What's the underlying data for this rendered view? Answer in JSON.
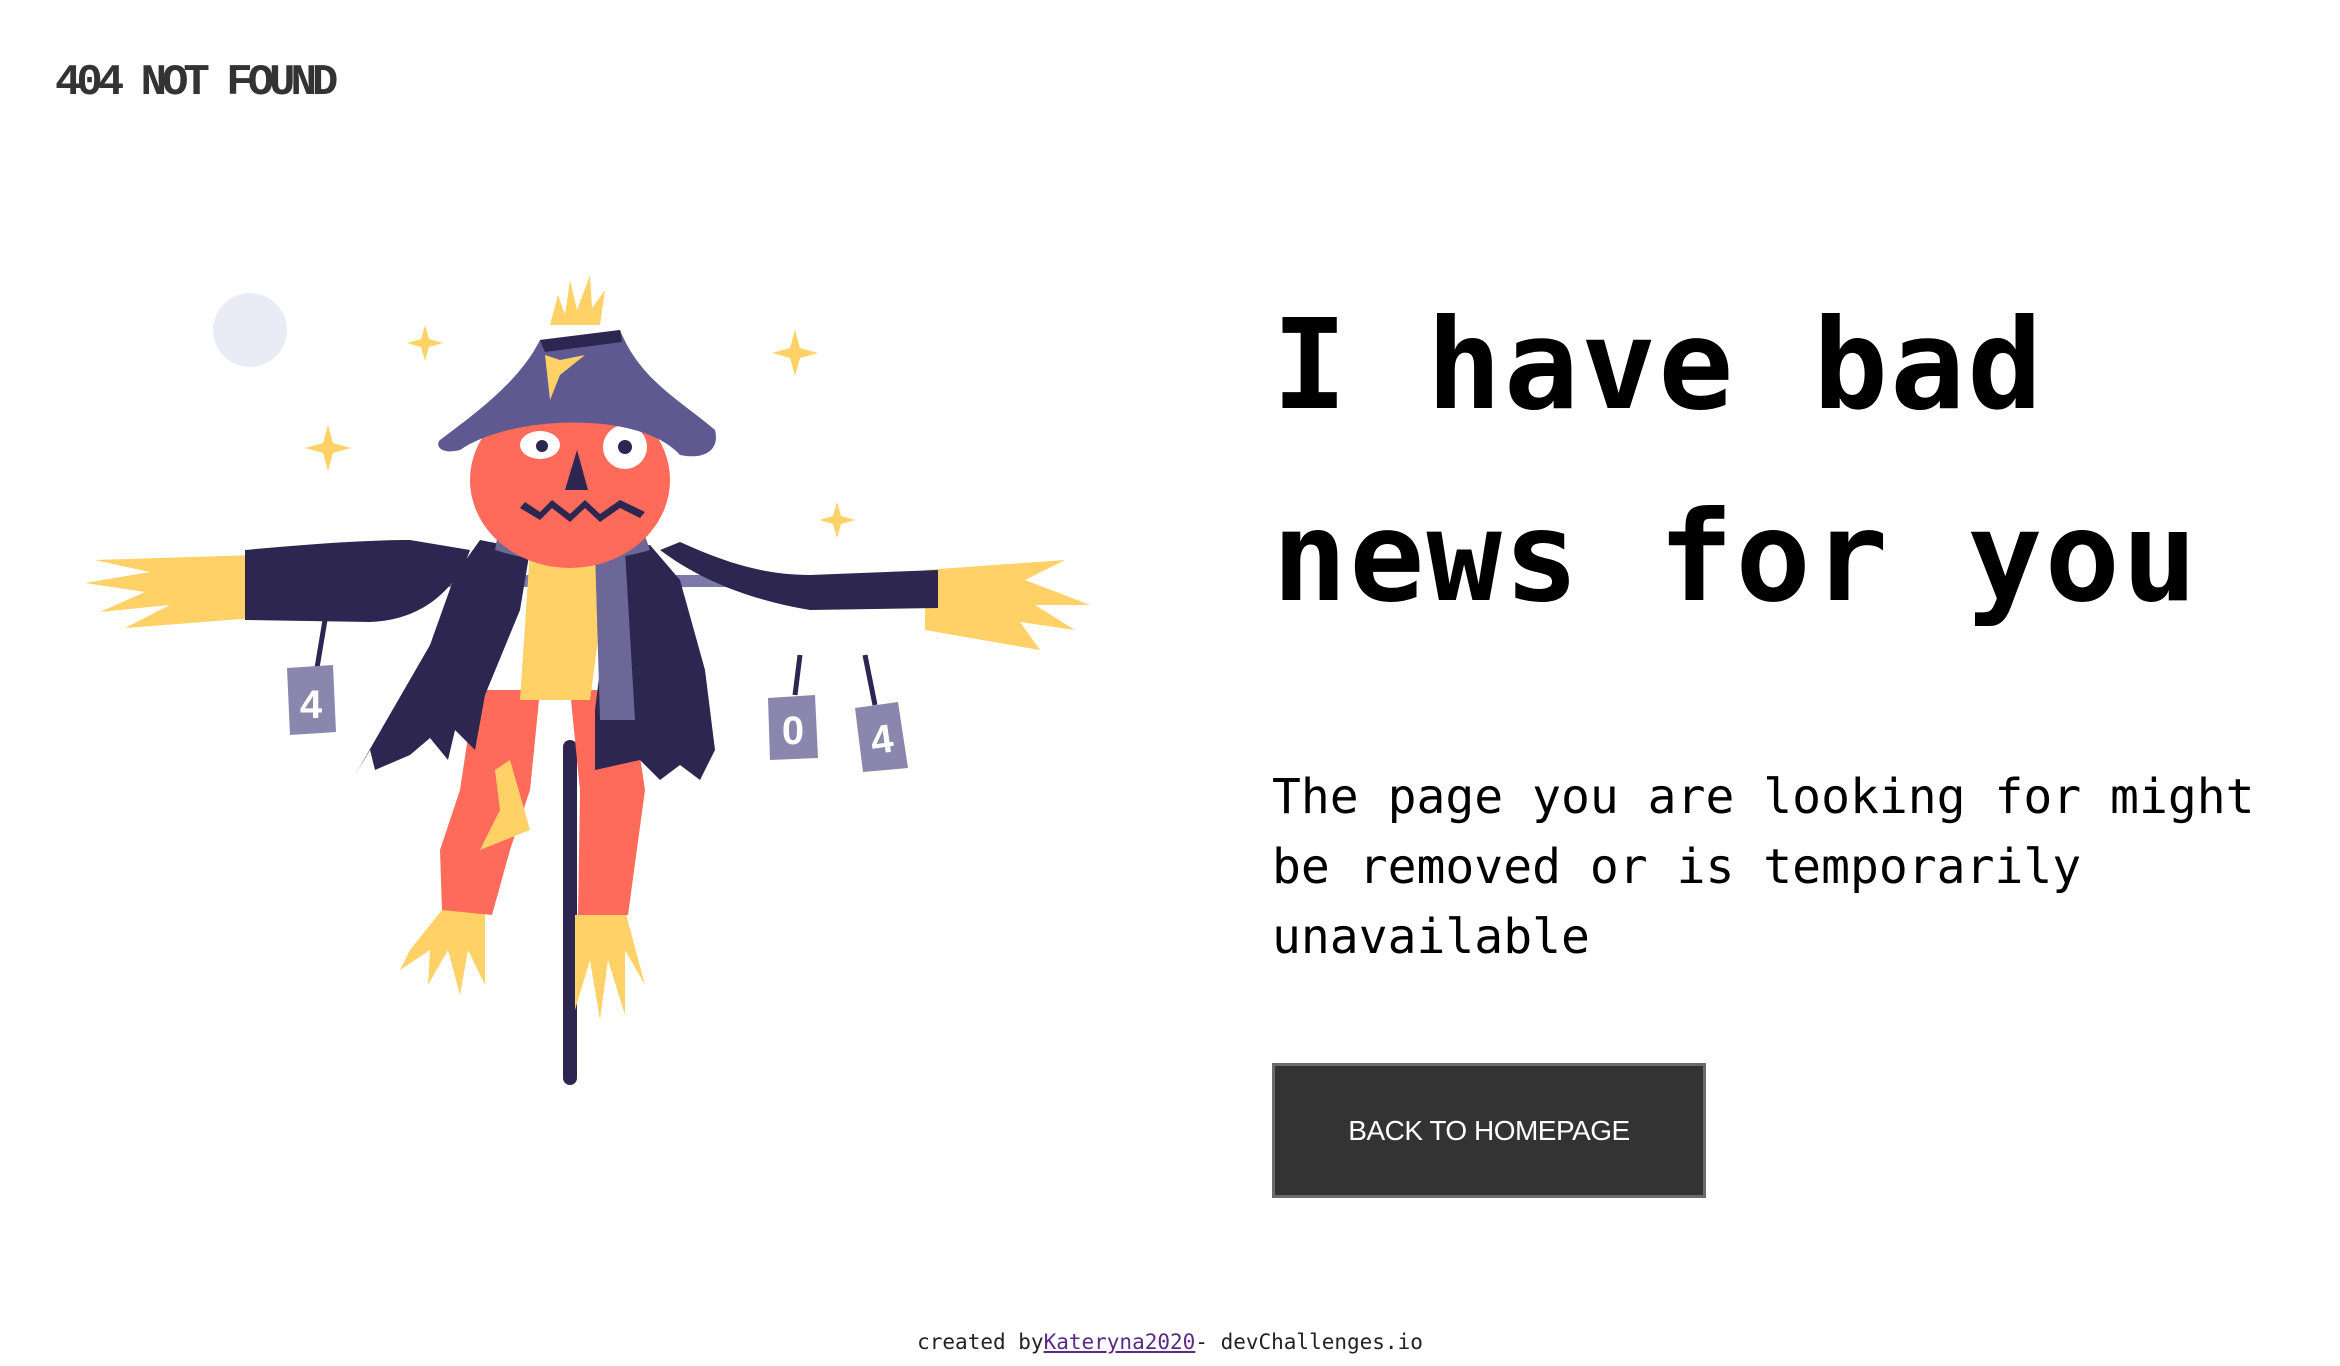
{
  "header": {
    "logo": "404 NOT FOUND"
  },
  "main": {
    "headline_line1": "I have bad",
    "headline_line2": "news for you",
    "message": "The page you are looking for might be removed or is temporarily unavailable",
    "button_label": "BACK TO HOMEPAGE"
  },
  "illustration": {
    "cans": [
      "4",
      "0",
      "4"
    ],
    "colors": {
      "coat": "#2c2650",
      "hat": "#5e5990",
      "face": "#ff6b5b",
      "straw": "#ffd166",
      "can": "#8a86ae",
      "moon": "#e9ebf6"
    }
  },
  "footer": {
    "prefix": "created by",
    "author": "Kateryna2020",
    "suffix": "- devChallenges.io"
  }
}
